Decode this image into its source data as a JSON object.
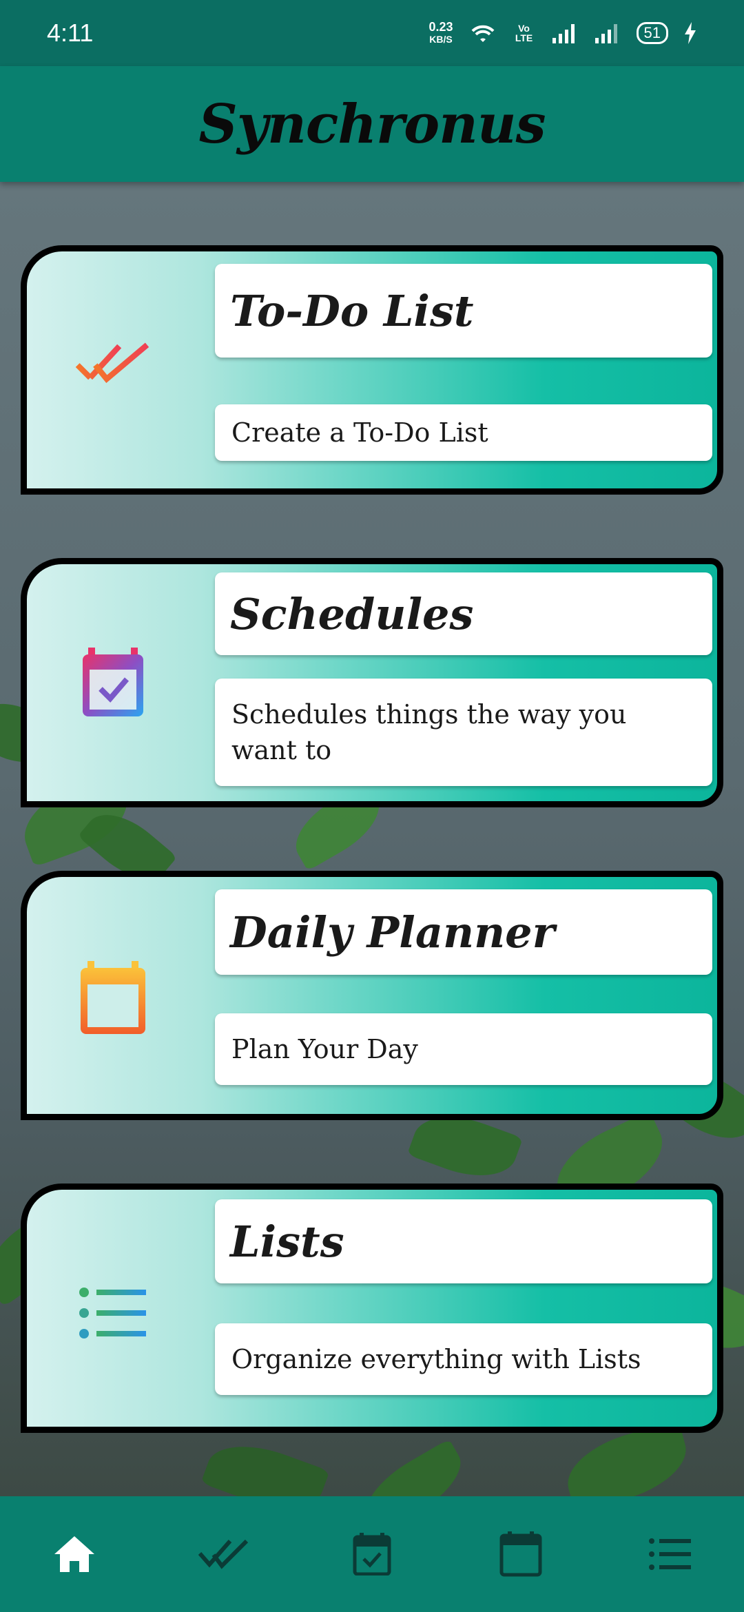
{
  "status_bar": {
    "time": "4:11",
    "net_speed_value": "0.23",
    "net_speed_unit": "KB/S",
    "volte_label": "Vo LTE",
    "battery": "51"
  },
  "app_bar": {
    "title": "Synchronus"
  },
  "cards": [
    {
      "title": "To-Do List",
      "description": "Create a To-Do List",
      "icon": "double-check-icon"
    },
    {
      "title": "Schedules",
      "description": "Schedules things the way you want to",
      "icon": "calendar-check-icon"
    },
    {
      "title": "Daily Planner",
      "description": "Plan Your Day",
      "icon": "calendar-icon"
    },
    {
      "title": "Lists",
      "description": "Organize everything with Lists",
      "icon": "list-icon"
    }
  ],
  "bottom_nav": [
    {
      "name": "home",
      "icon": "home-icon",
      "active": true
    },
    {
      "name": "todo",
      "icon": "double-check-icon",
      "active": false
    },
    {
      "name": "schedules",
      "icon": "calendar-check-icon",
      "active": false
    },
    {
      "name": "planner",
      "icon": "calendar-icon",
      "active": false
    },
    {
      "name": "lists",
      "icon": "list-icon",
      "active": false
    }
  ],
  "colors": {
    "status_bar": "#0b6e62",
    "app_bar": "#09806f",
    "card_gradient_start": "#d4f1ee",
    "card_gradient_end": "#0cb59c",
    "nav_icon_inactive": "#0b3b36"
  }
}
